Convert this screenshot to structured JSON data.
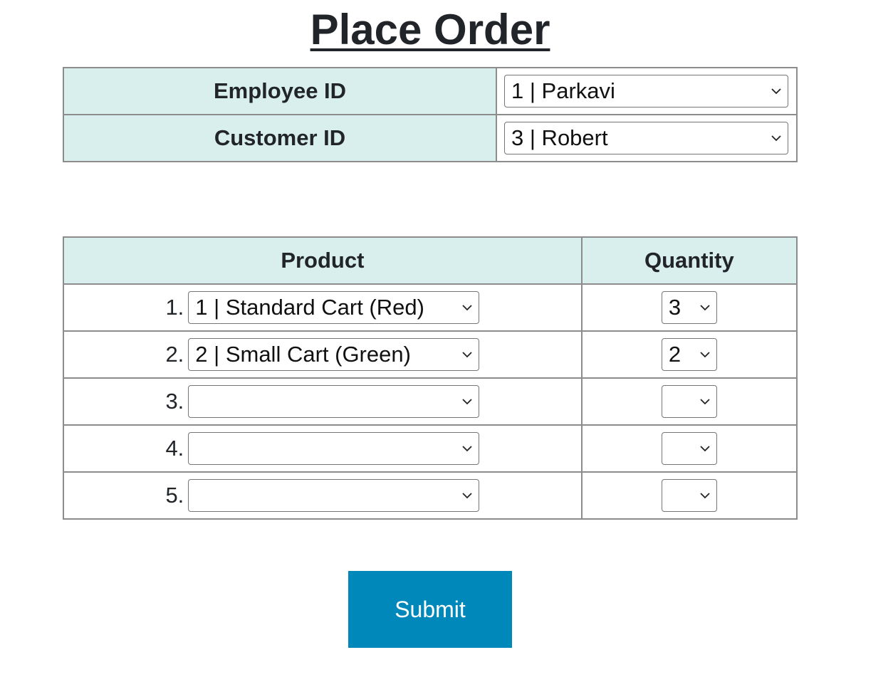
{
  "page": {
    "title": "Place Order"
  },
  "info": {
    "employee_label": "Employee ID",
    "employee_value": "1 | Parkavi",
    "customer_label": "Customer ID",
    "customer_value": "3 | Robert"
  },
  "products": {
    "headers": {
      "product": "Product",
      "quantity": "Quantity"
    },
    "rows": [
      {
        "num": "1.",
        "product": "1 | Standard Cart (Red)",
        "quantity": "3"
      },
      {
        "num": "2.",
        "product": "2 | Small Cart (Green)",
        "quantity": "2"
      },
      {
        "num": "3.",
        "product": "",
        "quantity": ""
      },
      {
        "num": "4.",
        "product": "",
        "quantity": ""
      },
      {
        "num": "5.",
        "product": "",
        "quantity": ""
      }
    ]
  },
  "actions": {
    "submit_label": "Submit"
  },
  "colors": {
    "header_bg": "#d9efee",
    "button_bg": "#0088bb",
    "border": "#8c8c8c"
  },
  "icons": {
    "select_arrow": "chevron-down-icon"
  }
}
